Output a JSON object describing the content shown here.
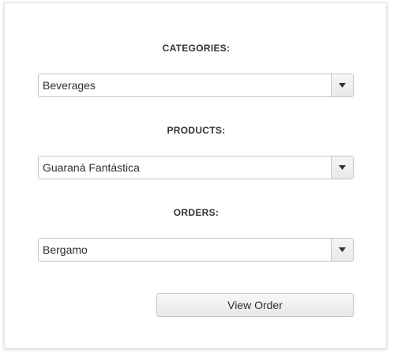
{
  "categories": {
    "label": "CATEGORIES:",
    "selected": "Beverages",
    "icon": "chevron-down-icon"
  },
  "products": {
    "label": "PRODUCTS:",
    "selected": "Guaraná Fantástica",
    "icon": "chevron-down-icon"
  },
  "orders": {
    "label": "ORDERS:",
    "selected": "Bergamo",
    "icon": "chevron-down-icon"
  },
  "actions": {
    "view_order_label": "View Order"
  },
  "colors": {
    "border": "#c5c5c5",
    "text": "#2e2e2e",
    "label": "#333333",
    "arrow": "#333333"
  }
}
